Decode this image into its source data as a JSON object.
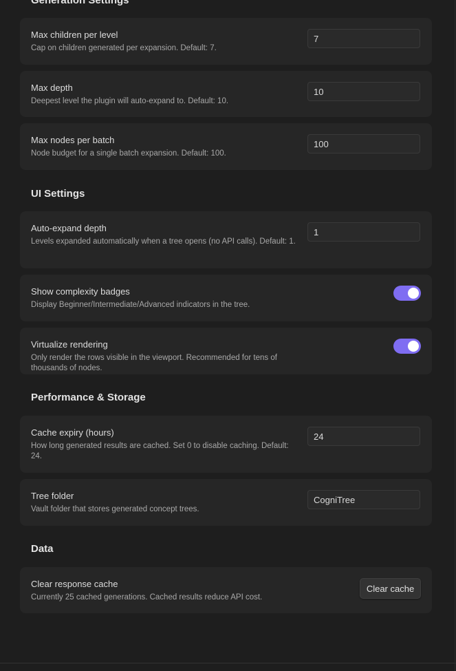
{
  "sections": {
    "generation": {
      "title": "Generation Settings"
    },
    "ui": {
      "title": "UI Settings"
    },
    "performance": {
      "title": "Performance & Storage"
    },
    "data": {
      "title": "Data"
    }
  },
  "settings": {
    "max_children": {
      "name": "Max children per level",
      "desc": "Cap on children generated per expansion. Default: 7.",
      "value": "7"
    },
    "max_depth": {
      "name": "Max depth",
      "desc": "Deepest level the plugin will auto-expand to. Default: 10.",
      "value": "10"
    },
    "max_nodes": {
      "name": "Max nodes per batch",
      "desc": "Node budget for a single batch expansion. Default: 100.",
      "value": "100"
    },
    "auto_expand": {
      "name": "Auto-expand depth",
      "desc": "Levels expanded automatically when a tree opens (no API calls). Default: 1.",
      "value": "1"
    },
    "complexity_badges": {
      "name": "Show complexity badges",
      "desc": "Display Beginner/Intermediate/Advanced indicators in the tree.",
      "enabled": true
    },
    "virtualize": {
      "name": "Virtualize rendering",
      "desc": "Only render the rows visible in the viewport. Recommended for tens of thousands of nodes.",
      "enabled": true
    },
    "cache_expiry": {
      "name": "Cache expiry (hours)",
      "desc": "How long generated results are cached. Set 0 to disable caching. Default: 24.",
      "value": "24"
    },
    "tree_folder": {
      "name": "Tree folder",
      "desc": "Vault folder that stores generated concept trees.",
      "value": "CogniTree"
    },
    "clear_cache": {
      "name": "Clear response cache",
      "desc": "Currently 25 cached generations. Cached results reduce API cost.",
      "button_label": "Clear cache"
    }
  },
  "colors": {
    "accent": "#7f6df2",
    "background": "#1e1e1e",
    "card": "#262626"
  }
}
